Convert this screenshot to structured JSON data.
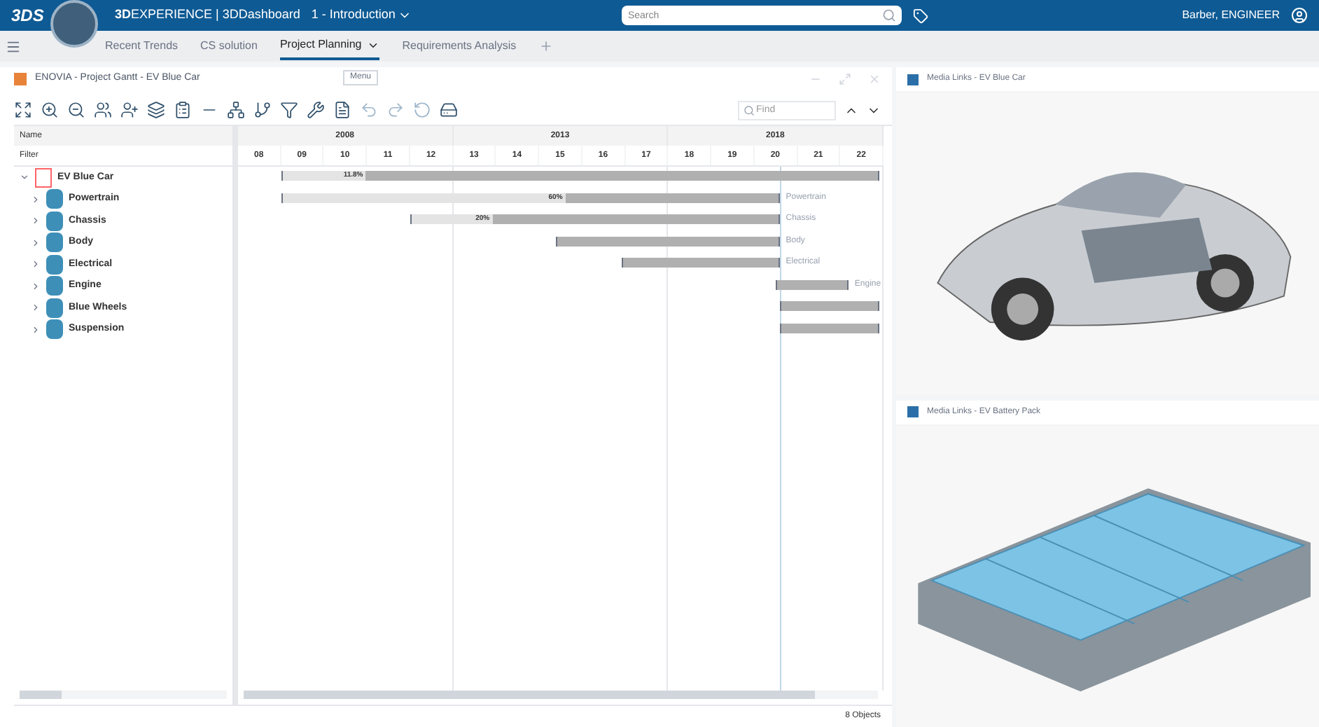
{
  "top_bar": {
    "brand": "3DS",
    "title_bold": "3D",
    "title_rest": "EXPERIENCE | 3DDashboard",
    "dashboard": "1 - Introduction",
    "search": {
      "placeholder": "Search"
    },
    "user": "Barber, ENGINEER"
  },
  "tabs": [
    {
      "label": "Recent Trends",
      "selected": false
    },
    {
      "label": "CS solution",
      "selected": false
    },
    {
      "label": "Project Planning",
      "selected": true
    },
    {
      "label": "Requirements Analysis",
      "selected": false
    }
  ],
  "tooltip": "Menu",
  "gantt_panel": {
    "title": "ENOVIA - Project Gantt - EV Blue Car",
    "find": {
      "placeholder": "Find"
    },
    "name_header": "Name",
    "filter_label": "Filter",
    "years": [
      "2008",
      "2013",
      "2018"
    ],
    "columns": [
      "08",
      "09",
      "10",
      "11",
      "12",
      "13",
      "14",
      "15",
      "16",
      "17",
      "18",
      "19",
      "20",
      "21",
      "22"
    ],
    "rows": [
      {
        "name": "EV Blue Car",
        "kind": "project",
        "expanded": true,
        "progress": "11.8%",
        "level": 0.14
      },
      {
        "name": "Powertrain",
        "kind": "phase",
        "expanded": false,
        "progress": "60%",
        "level": 0.57,
        "bar_label": "Powertrain"
      },
      {
        "name": "Chassis",
        "kind": "phase",
        "expanded": false,
        "progress": "20%",
        "level": 0.22,
        "bar_label": "Chassis"
      },
      {
        "name": "Body",
        "kind": "phase",
        "expanded": false,
        "bar_label": "Body"
      },
      {
        "name": "Electrical",
        "kind": "phase",
        "expanded": false,
        "bar_label": "Electrical"
      },
      {
        "name": "Engine",
        "kind": "phase",
        "expanded": false,
        "bar_label": "Engine"
      },
      {
        "name": "Blue Wheels",
        "kind": "phase",
        "expanded": false
      },
      {
        "name": "Suspension",
        "kind": "phase",
        "expanded": false
      }
    ],
    "status": "8 Objects"
  },
  "media_panels": [
    {
      "title": "Media Links - EV Blue Car",
      "kind": "car"
    },
    {
      "title": "Media Links - EV Battery Pack",
      "kind": "battery"
    }
  ]
}
